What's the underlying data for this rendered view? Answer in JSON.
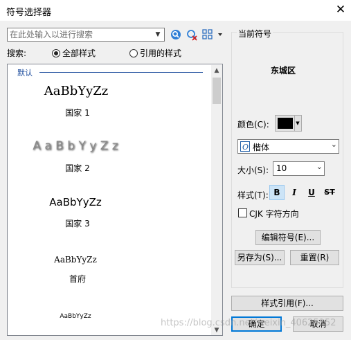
{
  "window": {
    "title": "符号选择器",
    "close_icon": "close-icon"
  },
  "search": {
    "placeholder": "在此处输入以进行搜索",
    "label": "搜索:",
    "option_all": "全部样式",
    "option_referenced": "引用的样式",
    "selected_option": "全部样式"
  },
  "list": {
    "group_label": "默认",
    "items": [
      {
        "sample": "AaBbYyZz",
        "name": "国家 1"
      },
      {
        "sample": "A a B b Y y Z z",
        "name": "国家 2"
      },
      {
        "sample": "AaBbYyZz",
        "name": "国家 3"
      },
      {
        "sample": "AaBbYyZz",
        "name": "首府"
      },
      {
        "sample": "AaBbYyZz",
        "name": ""
      }
    ]
  },
  "current_symbol": {
    "title": "当前符号",
    "preview_text": "东城区"
  },
  "properties": {
    "color_label": "颜色(C):",
    "color_value": "#000000",
    "font_value": "楷体",
    "size_label": "大小(S):",
    "size_value": "10",
    "style_label": "样式(T):",
    "bold": "B",
    "italic": "I",
    "underline": "U",
    "strikethrough": "ST",
    "cjk_label": "CJK 字符方向",
    "cjk_checked": false
  },
  "buttons": {
    "edit_symbol": "编辑符号(E)...",
    "save_as": "另存为(S)...",
    "reset": "重置(R)",
    "style_reference": "样式引用(F)...",
    "ok": "确定",
    "cancel": "取消"
  },
  "watermark": "https://blog.csdn.net/weixin_40625152",
  "colors": {
    "group_label": "#1f4e9e",
    "selected_style_button": "#cce4f7",
    "dialog_background": "#f0f0f0"
  }
}
